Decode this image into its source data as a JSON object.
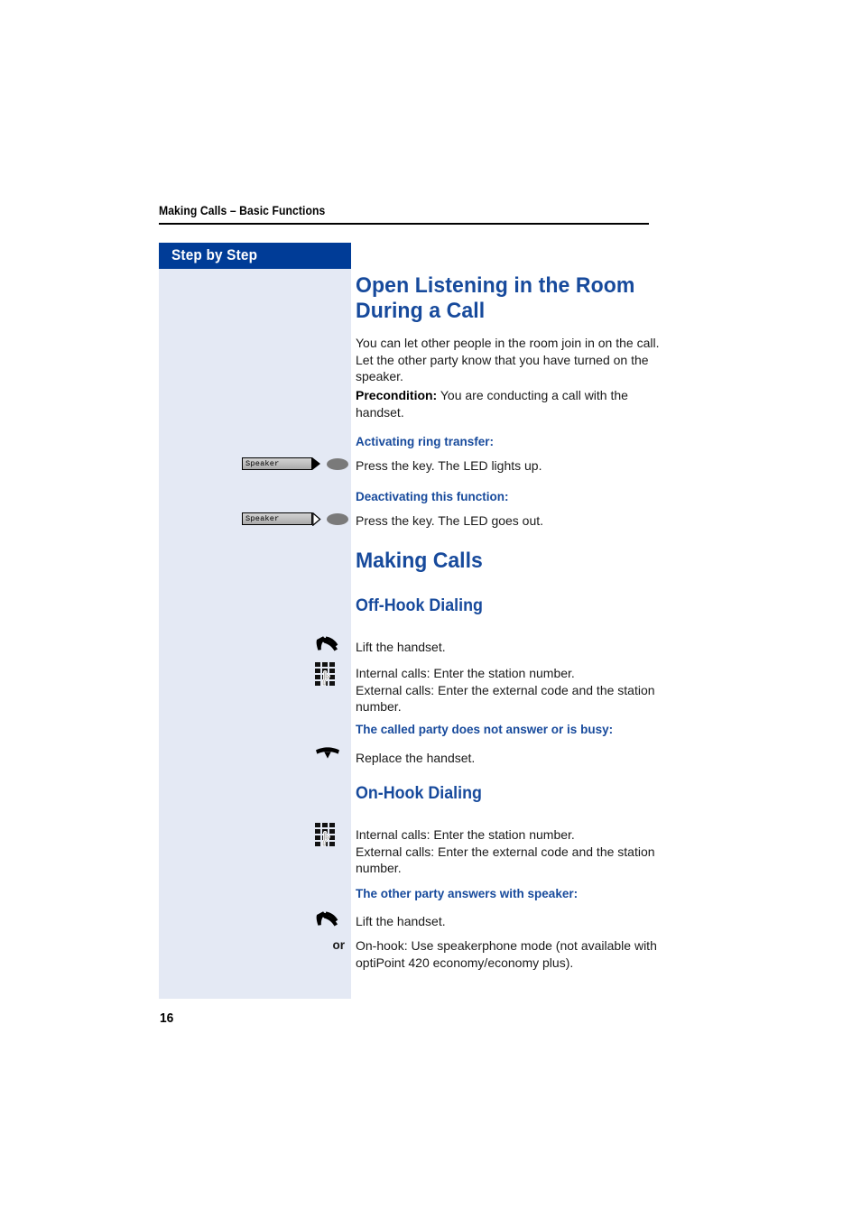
{
  "document": {
    "running_header": "Making Calls – Basic Functions",
    "page_number": "16"
  },
  "colors": {
    "heading_blue": "#174a9c",
    "sidebar_header_blue": "#003c97",
    "sidebar_background": "#e4e9f4",
    "body_text": "#1a1a1a"
  },
  "sidebar": {
    "header_label": "Step by Step"
  },
  "content": {
    "title": "Open Listening in the Room During a Call",
    "intro": "You can let other people in the room join in on the call. Let the other party know that you have turned on the speaker.",
    "precondition_label": "Precondition:",
    "precondition_text": " You are conducting a call with the handset.",
    "cue_activating": "Activating ring transfer:",
    "step_activating": "Press the key. The LED lights up.",
    "cue_deactivating": "Deactivating this function:",
    "step_deactivating": "Press the key. The LED goes out.",
    "section_making_calls": "Making Calls",
    "subsection_off_hook": "Off-Hook Dialing",
    "step_lift_handset_1": "Lift the handset.",
    "step_enter_number_1": "Internal calls: Enter the station number.\nExternal calls: Enter the external code and the station number.",
    "cue_no_answer": "The called party does not answer or is busy:",
    "step_replace_handset": "Replace the handset.",
    "subsection_on_hook": "On-Hook Dialing",
    "step_enter_number_2": "Internal calls: Enter the station number.\nExternal calls: Enter the external code and the station number.",
    "cue_other_party_answers": "The other party answers with speaker:",
    "step_lift_handset_2": "Lift the handset.",
    "or_label": "or",
    "step_on_hook_speakerphone": "On-hook: Use speakerphone mode (not available with optiPoint 420 economy/economy plus)."
  },
  "keys": {
    "speaker_label": "Speaker",
    "speaker_led_on_name": "speaker-key-led-on",
    "speaker_led_off_name": "speaker-key-led-off"
  },
  "icons": {
    "lift_handset": "lift-handset-icon",
    "replace_handset": "replace-handset-icon",
    "keypad": "keypad-icon",
    "speaker_key": "speaker-key-icon"
  }
}
